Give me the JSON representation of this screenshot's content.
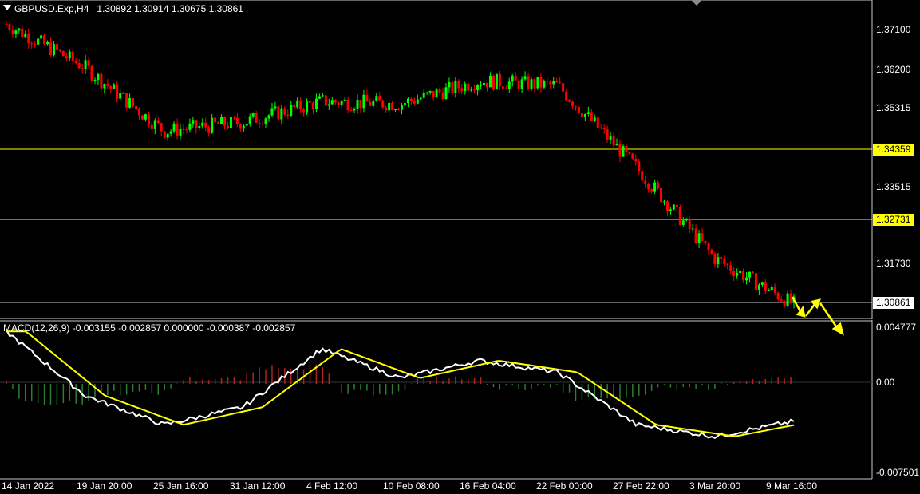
{
  "chart_header": {
    "symbol": "GBPUSD.Exp,H4",
    "open": "1.30892",
    "high": "1.30914",
    "low": "1.30675",
    "close": "1.30861"
  },
  "macd_header": {
    "label": "MACD(12,26,9) -0.003155 -0.002857 0.000000 -0.000387 -0.002857"
  },
  "price_axis": {
    "ticks": [
      "1.37100",
      "1.36200",
      "1.35315",
      "1.34359",
      "1.33515",
      "1.32731",
      "1.31730",
      "1.30861"
    ]
  },
  "macd_axis": {
    "ticks": [
      "0.004777",
      "0.00",
      "-0.007501"
    ]
  },
  "time_axis": {
    "labels": [
      "14 Jan 2022",
      "19 Jan 20:00",
      "25 Jan 16:00",
      "31 Jan 12:00",
      "4 Feb 12:00",
      "10 Feb 08:00",
      "16 Feb 04:00",
      "22 Feb 00:00",
      "27 Feb 22:00",
      "3 Mar 20:00",
      "9 Mar 16:00"
    ]
  },
  "horizontal_levels": {
    "resistance": "1.34359",
    "support": "1.32731",
    "current": "1.30861"
  },
  "colors": {
    "bull": "#00ff00",
    "bear": "#ff0000",
    "level": "#ffff00",
    "macd_signal": "#ffff00",
    "macd_line": "#ffffff",
    "hist_pos": "#b22222",
    "hist_neg": "#2e7d32"
  },
  "chart_data": {
    "type": "line",
    "title": "GBPUSD.Exp,H4",
    "price_path": [
      [
        "14 Jan 2022",
        1.3715
      ],
      [
        "19 Jan 20:00",
        1.362
      ],
      [
        "25 Jan 16:00",
        1.348
      ],
      [
        "31 Jan 12:00",
        1.35
      ],
      [
        "4 Feb 12:00",
        1.3545
      ],
      [
        "10 Feb 08:00",
        1.354
      ],
      [
        "16 Feb 04:00",
        1.359
      ],
      [
        "22 Feb 00:00",
        1.358
      ],
      [
        "27 Feb 22:00",
        1.34
      ],
      [
        "3 Mar 20:00",
        1.32
      ],
      [
        "9 Mar 16:00",
        1.31
      ]
    ],
    "macd_main": [
      [
        "14 Jan 2022",
        0.0045
      ],
      [
        "19 Jan 20:00",
        -0.001
      ],
      [
        "25 Jan 16:00",
        -0.0035
      ],
      [
        "31 Jan 12:00",
        -0.002
      ],
      [
        "4 Feb 12:00",
        0.003
      ],
      [
        "10 Feb 08:00",
        0.0005
      ],
      [
        "16 Feb 04:00",
        0.002
      ],
      [
        "22 Feb 00:00",
        0.001
      ],
      [
        "27 Feb 22:00",
        -0.0035
      ],
      [
        "3 Mar 20:00",
        -0.0045
      ],
      [
        "9 Mar 16:00",
        -0.0032
      ]
    ],
    "ylim_price": [
      1.305,
      1.375
    ],
    "ylim_macd": [
      -0.008,
      0.005
    ]
  }
}
